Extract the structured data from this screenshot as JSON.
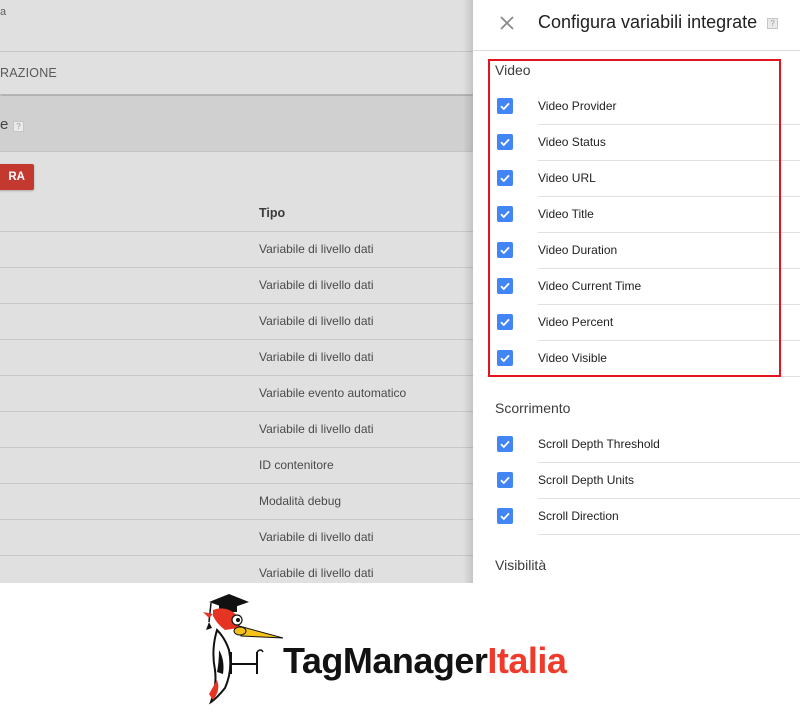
{
  "background_page": {
    "top_fragment": "a",
    "nav_fragment": "RAZIONE",
    "section_title_fragment": "e",
    "help_glyph": "?",
    "action_button_fragment": "RA",
    "table": {
      "type_column_header": "Tipo",
      "rows": [
        {
          "tipo": "Variabile di livello dati"
        },
        {
          "tipo": "Variabile di livello dati"
        },
        {
          "tipo": "Variabile di livello dati"
        },
        {
          "tipo": "Variabile di livello dati"
        },
        {
          "tipo": "Variabile evento automatico"
        },
        {
          "tipo": "Variabile di livello dati"
        },
        {
          "tipo": "ID contenitore"
        },
        {
          "tipo": "Modalità debug"
        },
        {
          "tipo": "Variabile di livello dati"
        },
        {
          "tipo": "Variabile di livello dati"
        }
      ]
    }
  },
  "panel": {
    "title": "Configura variabili integrate",
    "close_icon": "close-icon",
    "help_glyph": "?",
    "groups": [
      {
        "title": "Video",
        "highlighted": true,
        "items": [
          {
            "label": "Video Provider",
            "checked": true
          },
          {
            "label": "Video Status",
            "checked": true
          },
          {
            "label": "Video URL",
            "checked": true
          },
          {
            "label": "Video Title",
            "checked": true
          },
          {
            "label": "Video Duration",
            "checked": true
          },
          {
            "label": "Video Current Time",
            "checked": true
          },
          {
            "label": "Video Percent",
            "checked": true
          },
          {
            "label": "Video Visible",
            "checked": true
          }
        ]
      },
      {
        "title": "Scorrimento",
        "highlighted": false,
        "items": [
          {
            "label": "Scroll Depth Threshold",
            "checked": true
          },
          {
            "label": "Scroll Depth Units",
            "checked": true
          },
          {
            "label": "Scroll Direction",
            "checked": true
          }
        ]
      },
      {
        "title": "Visibilità",
        "highlighted": false,
        "items": []
      }
    ]
  },
  "colors": {
    "checkbox": "#4285f4",
    "highlight_border": "#e3141f",
    "action_button": "#c3392f",
    "logo_red": "#ee3b2b",
    "logo_dark": "#121212"
  },
  "logo": {
    "text_dark": "TagManager",
    "text_red": "Italia",
    "mascot_icon": "woodpecker-graduate-icon"
  }
}
